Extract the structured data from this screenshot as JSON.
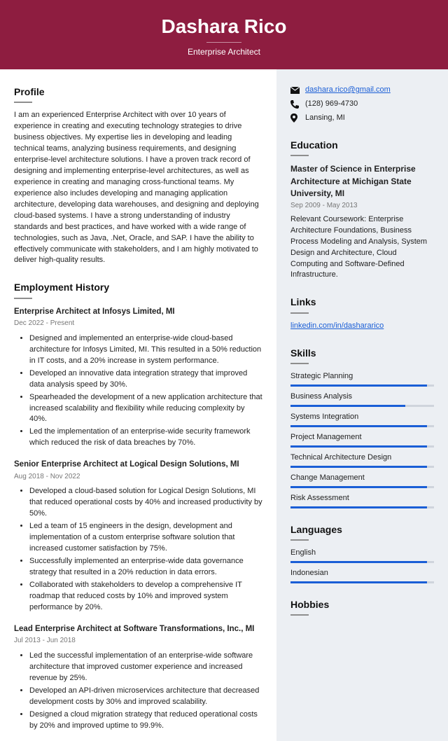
{
  "header": {
    "name": "Dashara Rico",
    "subtitle": "Enterprise Architect"
  },
  "profile": {
    "heading": "Profile",
    "text": "I am an experienced Enterprise Architect with over 10 years of experience in creating and executing technology strategies to drive business objectives. My expertise lies in developing and leading technical teams, analyzing business requirements, and designing enterprise-level architecture solutions. I have a proven track record of designing and implementing enterprise-level architectures, as well as experience in creating and managing cross-functional teams. My experience also includes developing and managing application architecture, developing data warehouses, and designing and deploying cloud-based systems. I have a strong understanding of industry standards and best practices, and have worked with a wide range of technologies, such as Java, .Net, Oracle, and SAP. I have the ability to effectively communicate with stakeholders, and I am highly motivated to deliver high-quality results."
  },
  "employment": {
    "heading": "Employment History",
    "jobs": [
      {
        "title": "Enterprise Architect at Infosys Limited, MI",
        "date": "Dec 2022 - Present",
        "bullets": [
          "Designed and implemented an enterprise-wide cloud-based architecture for Infosys Limited, MI. This resulted in a 50% reduction in IT costs, and a 20% increase in system performance.",
          "Developed an innovative data integration strategy that improved data analysis speed by 30%.",
          "Spearheaded the development of a new application architecture that increased scalability and flexibility while reducing complexity by 40%.",
          "Led the implementation of an enterprise-wide security framework which reduced the risk of data breaches by 70%."
        ]
      },
      {
        "title": "Senior Enterprise Architect at Logical Design Solutions, MI",
        "date": "Aug 2018 - Nov 2022",
        "bullets": [
          "Developed a cloud-based solution for Logical Design Solutions, MI that reduced operational costs by 40% and increased productivity by 50%.",
          "Led a team of 15 engineers in the design, development and implementation of a custom enterprise software solution that increased customer satisfaction by 75%.",
          "Successfully implemented an enterprise-wide data governance strategy that resulted in a 20% reduction in data errors.",
          "Collaborated with stakeholders to develop a comprehensive IT roadmap that reduced costs by 10% and improved system performance by 20%."
        ]
      },
      {
        "title": "Lead Enterprise Architect at Software Transformations, Inc., MI",
        "date": "Jul 2013 - Jun 2018",
        "bullets": [
          "Led the successful implementation of an enterprise-wide software architecture that improved customer experience and increased revenue by 25%.",
          "Developed an API-driven microservices architecture that decreased development costs by 30% and improved scalability.",
          "Designed a cloud migration strategy that reduced operational costs by 20% and improved uptime to 99.9%."
        ]
      }
    ]
  },
  "contact": {
    "email": "dashara.rico@gmail.com",
    "phone": "(128) 969-4730",
    "location": "Lansing, MI"
  },
  "education": {
    "heading": "Education",
    "title": "Master of Science in Enterprise Architecture at Michigan State University, MI",
    "date": "Sep 2009 - May 2013",
    "course": "Relevant Coursework: Enterprise Architecture Foundations, Business Process Modeling and Analysis, System Design and Architecture, Cloud Computing and Software-Defined Infrastructure."
  },
  "links": {
    "heading": "Links",
    "items": [
      "linkedin.com/in/dashararico"
    ]
  },
  "skills": {
    "heading": "Skills",
    "items": [
      {
        "name": "Strategic Planning",
        "pct": 95
      },
      {
        "name": "Business Analysis",
        "pct": 80
      },
      {
        "name": "Systems Integration",
        "pct": 95
      },
      {
        "name": "Project Management",
        "pct": 95
      },
      {
        "name": "Technical Architecture Design",
        "pct": 95
      },
      {
        "name": "Change Management",
        "pct": 95
      },
      {
        "name": "Risk Assessment",
        "pct": 95
      }
    ]
  },
  "languages": {
    "heading": "Languages",
    "items": [
      {
        "name": "English",
        "pct": 95
      },
      {
        "name": "Indonesian",
        "pct": 95
      }
    ]
  },
  "hobbies": {
    "heading": "Hobbies"
  }
}
